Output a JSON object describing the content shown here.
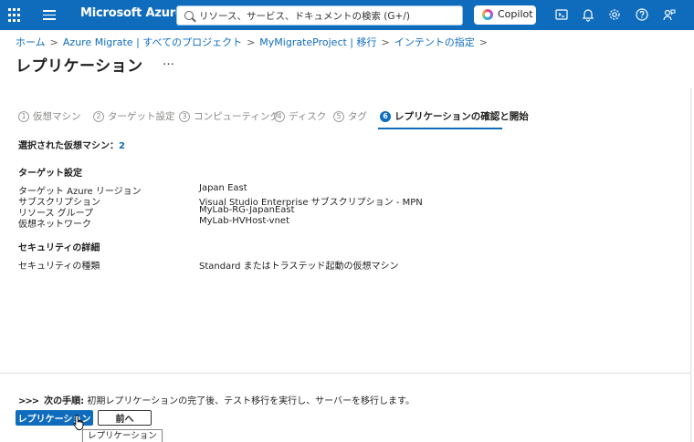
{
  "topbar": {
    "brand": "Microsoft Azure",
    "search_placeholder": "リソース、サービス、ドキュメントの検索 (G+/)",
    "copilot_label": "Copilot",
    "icons": [
      "waffle-icon",
      "hamburger-icon",
      "search-icon",
      "copilot-icon",
      "cloud-shell-icon",
      "bell-icon",
      "gear-icon",
      "help-icon",
      "feedback-icon"
    ],
    "bar_color": "#0f6cbd"
  },
  "breadcrumb": {
    "items": [
      "ホーム",
      "Azure Migrate | すべてのプロジェクト",
      "MyMigrateProject | 移行",
      "インテントの指定"
    ],
    "separator": ">"
  },
  "page": {
    "title": "レプリケーション",
    "more": "…"
  },
  "steps": [
    {
      "num": "1",
      "label": "仮想マシン"
    },
    {
      "num": "2",
      "label": "ターゲット設定"
    },
    {
      "num": "3",
      "label": "コンピューティング"
    },
    {
      "num": "4",
      "label": "ディスク"
    },
    {
      "num": "5",
      "label": "タグ"
    },
    {
      "num": "6",
      "label": "レプリケーションの確認と開始",
      "active": true
    }
  ],
  "review": {
    "selected_label": "選択された仮想マシン：",
    "selected_count": "2",
    "target_heading": "ターゲット設定",
    "target_rows": [
      {
        "key": "ターゲット Azure リージョン",
        "value": "Japan East"
      },
      {
        "key": "サブスクリプション",
        "value": "Visual Studio Enterprise サブスクリプション - MPN"
      },
      {
        "key": "リソース グループ",
        "value": "MyLab-RG-JapanEast"
      },
      {
        "key": "仮想ネットワーク",
        "value": "MyLab-HVHost-vnet"
      }
    ],
    "security_heading": "セキュリティの詳細",
    "security_rows": [
      {
        "key": "セキュリティの種類",
        "value": "Standard またはトラステッド起動の仮想マシン"
      }
    ]
  },
  "footer": {
    "arrows": ">>>",
    "next_label": "次の手順:",
    "next_text": " 初期レプリケーションの完了後、テスト移行を実行し、サーバーを移行します。",
    "primary_button": "レプリケーション",
    "secondary_button": "前へ",
    "tooltip": "レプリケーション"
  }
}
